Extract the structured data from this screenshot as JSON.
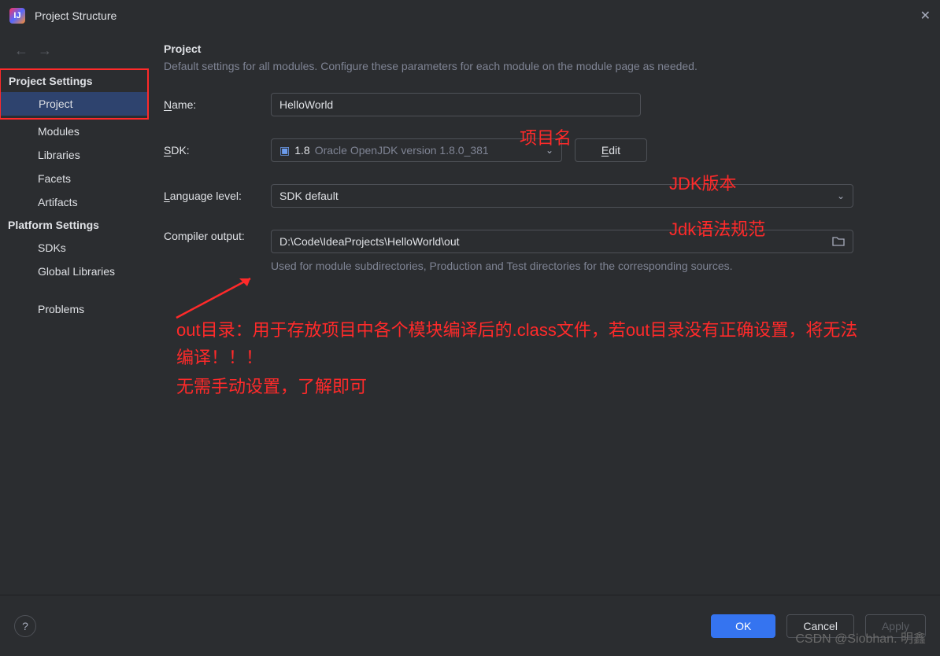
{
  "window": {
    "title": "Project Structure"
  },
  "sidebar": {
    "sections": {
      "project_settings": "Project Settings",
      "platform_settings": "Platform Settings"
    },
    "items": {
      "project": "Project",
      "modules": "Modules",
      "libraries": "Libraries",
      "facets": "Facets",
      "artifacts": "Artifacts",
      "sdks": "SDKs",
      "global_libraries": "Global Libraries",
      "problems": "Problems"
    }
  },
  "main": {
    "title": "Project",
    "subtitle": "Default settings for all modules. Configure these parameters for each module on the module page as needed.",
    "name_label": "Name:",
    "name_value": "HelloWorld",
    "sdk_label": "SDK:",
    "sdk_version": "1.8",
    "sdk_desc": "Oracle OpenJDK version 1.8.0_381",
    "edit_label": "Edit",
    "lang_label": "Language level:",
    "lang_value": "SDK default",
    "out_label": "Compiler output:",
    "out_value": "D:\\Code\\IdeaProjects\\HelloWorld\\out",
    "out_hint": "Used for module subdirectories, Production and Test directories for the corresponding sources."
  },
  "annotations": {
    "project_name": "项目名",
    "jdk_version": "JDK版本",
    "jdk_syntax": "Jdk语法规范",
    "out_desc_1": "out目录：用于存放项目中各个模块编译后的.class文件，若out目录没有正确设置，将无法编译！！！",
    "out_desc_2": "无需手动设置，了解即可"
  },
  "buttons": {
    "ok": "OK",
    "cancel": "Cancel",
    "apply": "Apply"
  },
  "watermark": "CSDN @Siobhan. 明鑫"
}
